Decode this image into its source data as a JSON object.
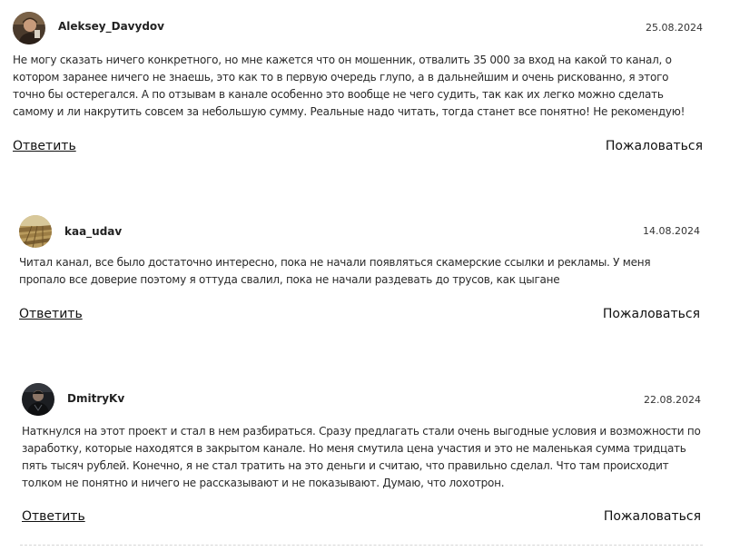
{
  "comments": [
    {
      "author": "Aleksey_Davydov",
      "date": "25.08.2024",
      "avatar": "avatar-photo-man",
      "text": "Не могу сказать ничего конкретного, но мне кажется что он мошенник, отвалить 35 000 за вход на какой то канал, о котором заранее ничего не знаешь, это как то в первую очередь глупо, а в дальнейшим и очень рискованно, я этого точно бы остерегался. А по отзывам в канале особенно это вообще не чего судить, так как их легко можно сделать самому и ли накрутить совсем за небольшую сумму. Реальные надо читать, тогда станет все понятно! Не рекомендую!",
      "reply_label": "Ответить",
      "report_label": "Пожаловаться"
    },
    {
      "author": "kaa_udav",
      "date": "14.08.2024",
      "avatar": "avatar-photo-field",
      "text": "Читал канал, все было достаточно интересно, пока не начали появляться скамерские ссылки и рекламы. У меня пропало все доверие поэтому я оттуда свалил, пока не начали раздевать до трусов, как цыгане",
      "reply_label": "Ответить",
      "report_label": "Пожаловаться"
    },
    {
      "author": "DmitryKv",
      "date": "22.08.2024",
      "avatar": "avatar-photo-dark",
      "text": "Наткнулся на этот проект и стал в нем разбираться. Сразу предлагать стали очень выгодные условия и возможности по заработку, которые находятся в закрытом канале. Но меня смутила цена участия и это не маленькая сумма тридцать пять тысяч рублей. Конечно, я не стал тратить на это деньги и считаю, что правильно сделал. Что там происходит толком не понятно и ничего не рассказывают и не показывают. Думаю, что лохотрон.",
      "reply_label": "Ответить",
      "report_label": "Пожаловаться"
    }
  ]
}
